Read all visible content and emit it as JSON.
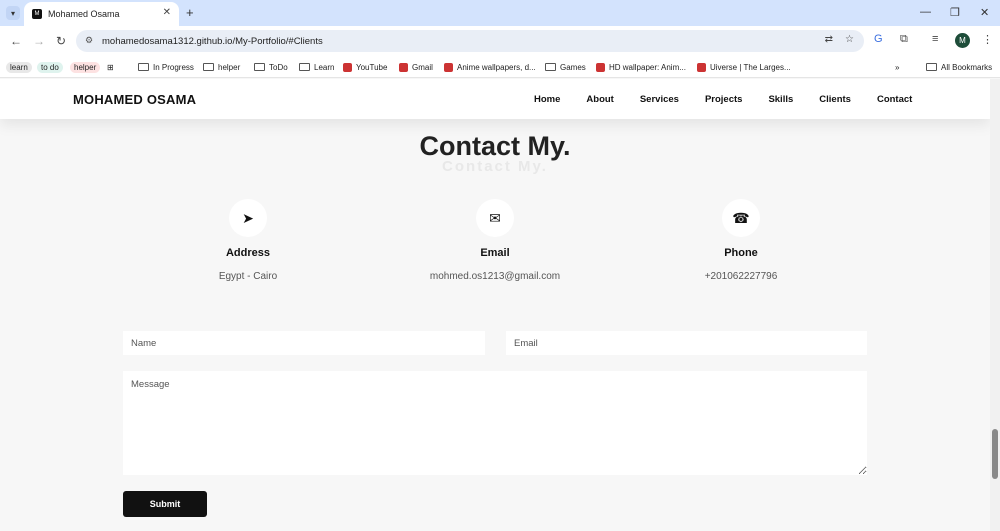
{
  "browser": {
    "tab_title": "Mohamed Osama",
    "url": "mohamedosama1312.github.io/My-Portfolio/#Clients",
    "bookmarks": [
      {
        "label": "learn",
        "kind": "chip",
        "color": "#e8e8e8"
      },
      {
        "label": "to do",
        "kind": "chip",
        "color": "#dff3ee"
      },
      {
        "label": "helper",
        "kind": "chip",
        "color": "#fde2e2"
      },
      {
        "label": "In Progress",
        "kind": "folder"
      },
      {
        "label": "helper",
        "kind": "folder"
      },
      {
        "label": "ToDo",
        "kind": "folder"
      },
      {
        "label": "Learn",
        "kind": "folder"
      },
      {
        "label": "YouTube",
        "kind": "site"
      },
      {
        "label": "Gmail",
        "kind": "site"
      },
      {
        "label": "Anime wallpapers, d...",
        "kind": "site"
      },
      {
        "label": "Games",
        "kind": "folder"
      },
      {
        "label": "HD wallpaper: Anim...",
        "kind": "site"
      },
      {
        "label": "Uiverse | The Larges...",
        "kind": "site"
      }
    ],
    "all_bookmarks": "All Bookmarks",
    "avatar_letter": "M"
  },
  "site": {
    "brand": "MOHAMED OSAMA",
    "nav": [
      "Home",
      "About",
      "Services",
      "Projects",
      "Skills",
      "Clients",
      "Contact"
    ]
  },
  "contact": {
    "title": "Contact My.",
    "items": [
      {
        "icon": "location-arrow-icon",
        "label": "Address",
        "value": "Egypt - Cairo"
      },
      {
        "icon": "envelope-icon",
        "label": "Email",
        "value": "mohmed.os1213@gmail.com"
      },
      {
        "icon": "phone-icon",
        "label": "Phone",
        "value": "+201062227796"
      }
    ],
    "form": {
      "name_placeholder": "Name",
      "email_placeholder": "Email",
      "message_placeholder": "Message",
      "submit_label": "Submit"
    }
  }
}
